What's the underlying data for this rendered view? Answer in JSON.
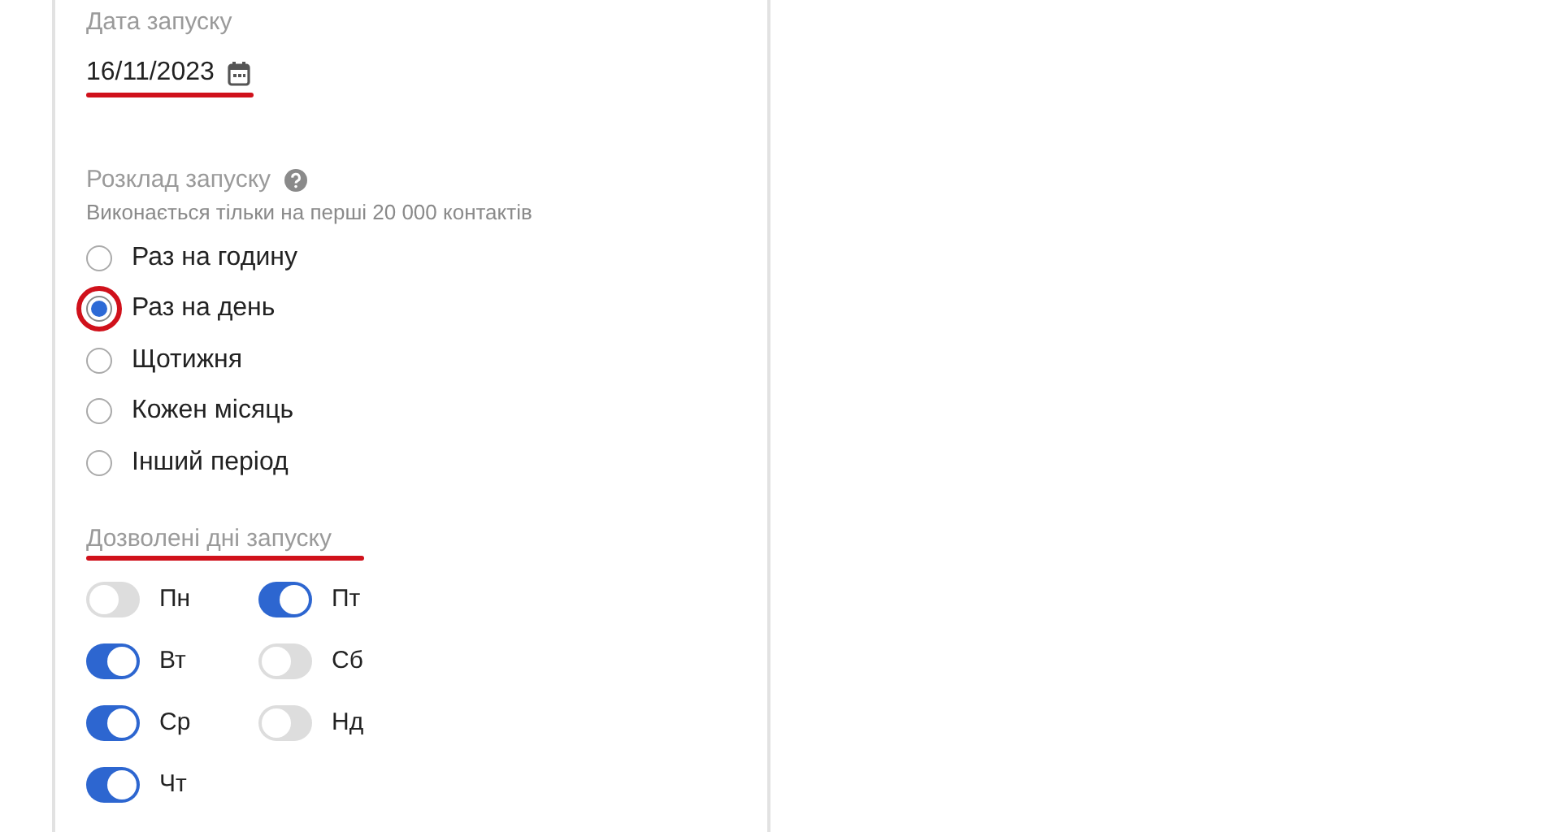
{
  "launch_date": {
    "label": "Дата запуску",
    "value": "16/11/2023"
  },
  "schedule": {
    "label": "Розклад запуску",
    "hint": "Виконається тільки на перші 20 000 контактів",
    "options": [
      {
        "label": "Раз на годину",
        "selected": false
      },
      {
        "label": "Раз на день",
        "selected": true
      },
      {
        "label": "Щотижня",
        "selected": false
      },
      {
        "label": "Кожен місяць",
        "selected": false
      },
      {
        "label": "Інший період",
        "selected": false
      }
    ]
  },
  "allowed_days": {
    "label": "Дозволені дні запуску",
    "days": [
      {
        "label": "Пн",
        "on": false
      },
      {
        "label": "Вт",
        "on": true
      },
      {
        "label": "Ср",
        "on": true
      },
      {
        "label": "Чт",
        "on": true
      },
      {
        "label": "Пт",
        "on": true
      },
      {
        "label": "Сб",
        "on": false
      },
      {
        "label": "Нд",
        "on": false
      }
    ]
  }
}
